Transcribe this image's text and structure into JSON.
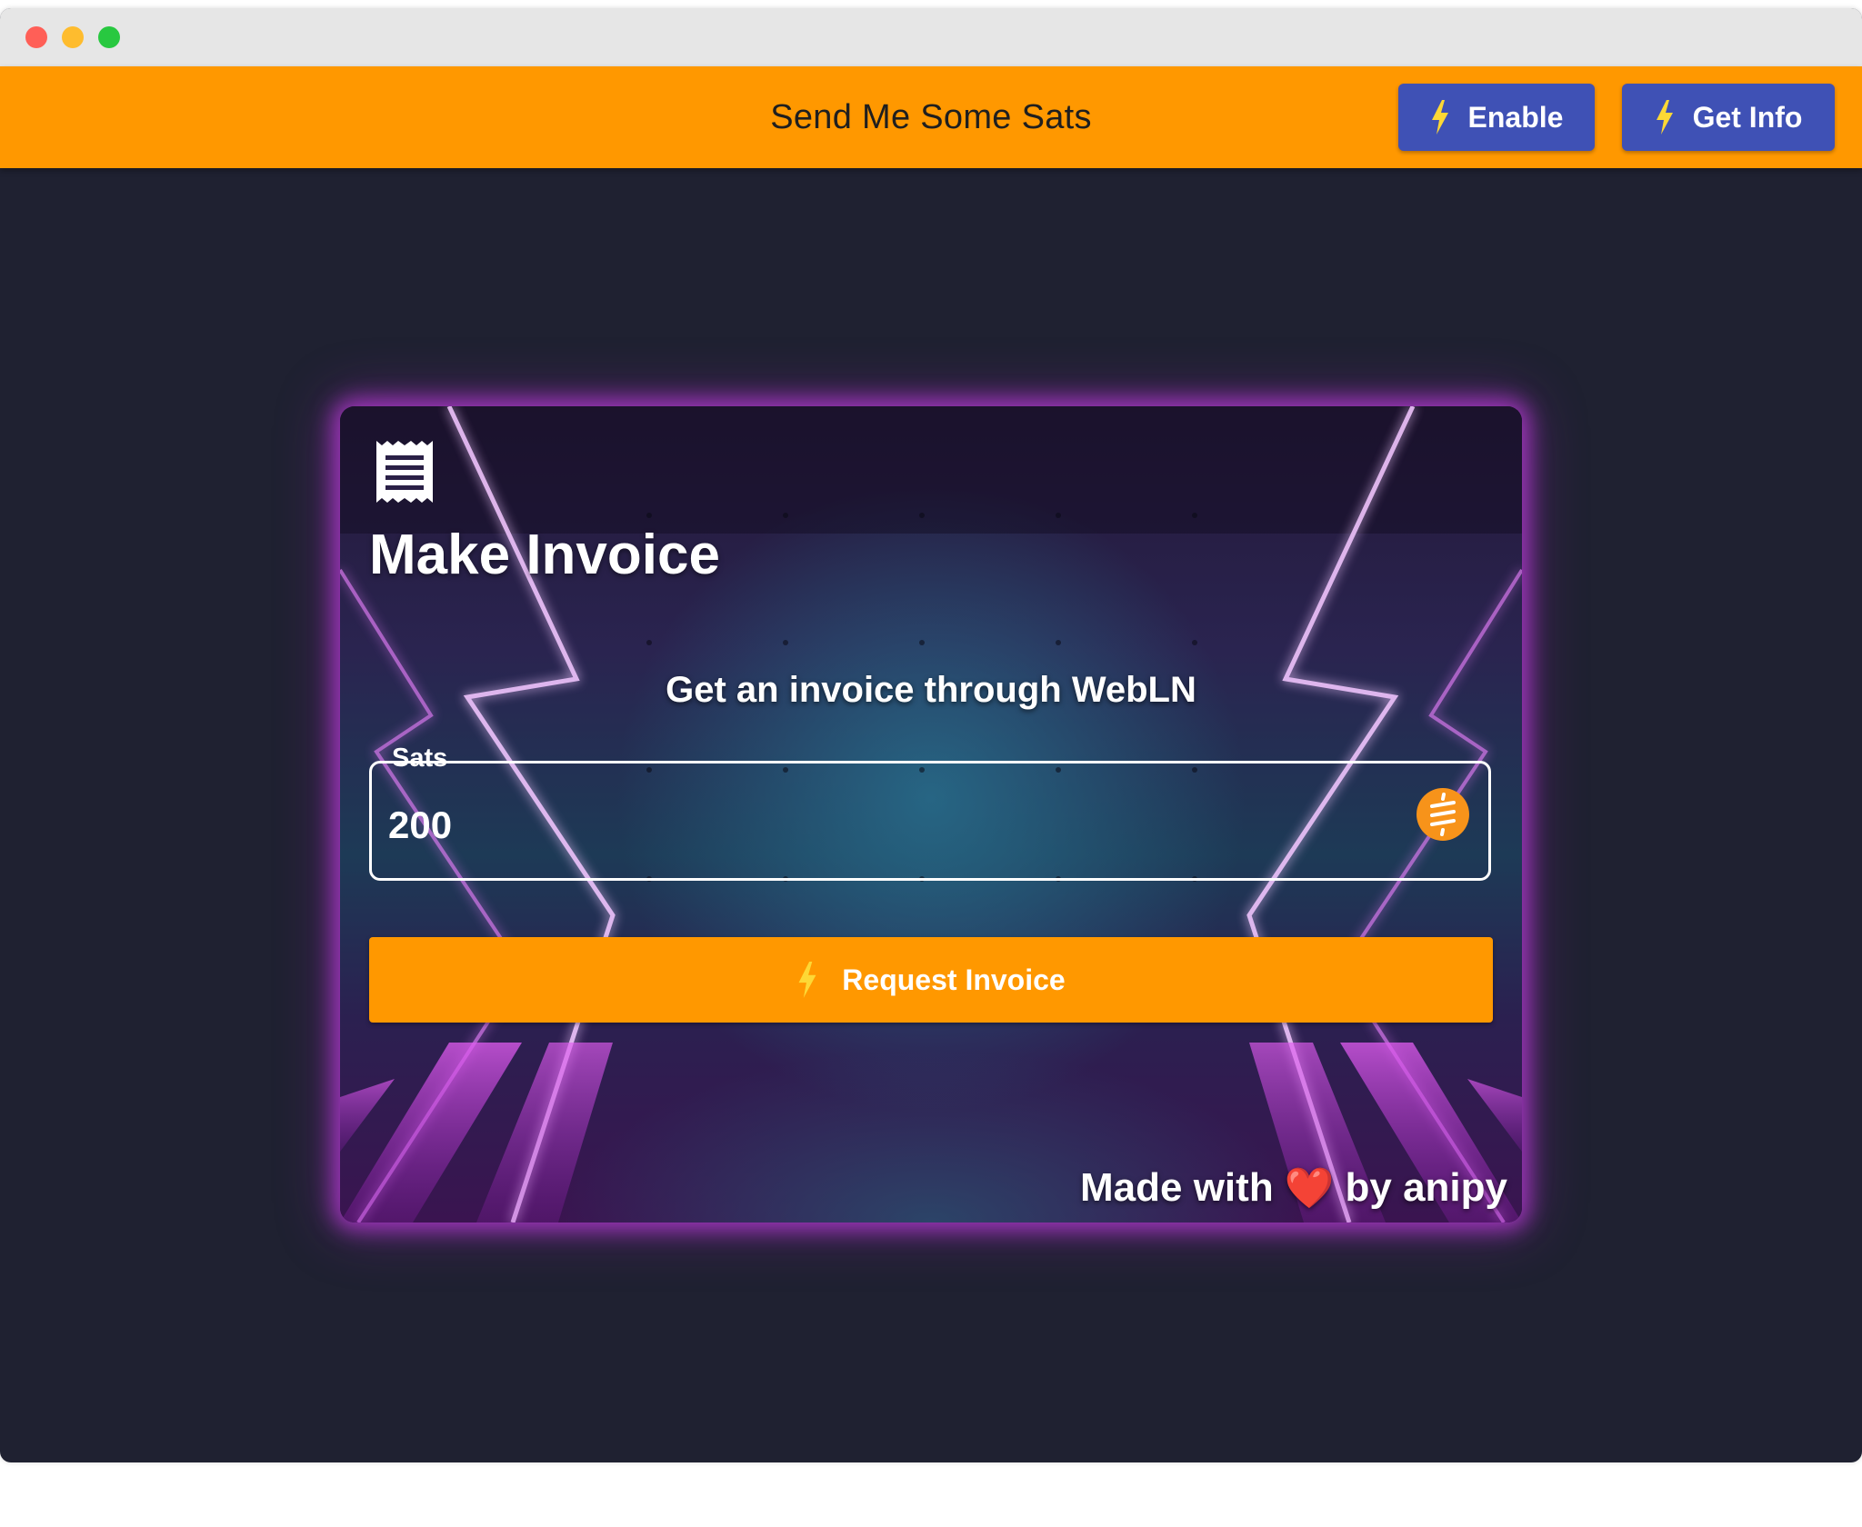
{
  "window": {
    "controls": [
      "close",
      "minimize",
      "maximize"
    ]
  },
  "appbar": {
    "title": "Send Me Some Sats",
    "enable_label": "Enable",
    "get_info_label": "Get Info",
    "background_color": "#ff9800",
    "button_color": "#3f51b5"
  },
  "card": {
    "icon": "receipt-icon",
    "title": "Make Invoice",
    "subtitle": "Get an invoice through WebLN",
    "sats_field": {
      "label": "Sats",
      "value": "200",
      "icon": "satoshi-icon"
    },
    "request_button_label": "Request Invoice",
    "footer": {
      "prefix": "Made with",
      "heart": "❤️",
      "suffix": "by anipy"
    }
  },
  "colors": {
    "page_background": "#1f2131",
    "accent_orange": "#ff9800",
    "card_glow": "#be3cdc"
  }
}
